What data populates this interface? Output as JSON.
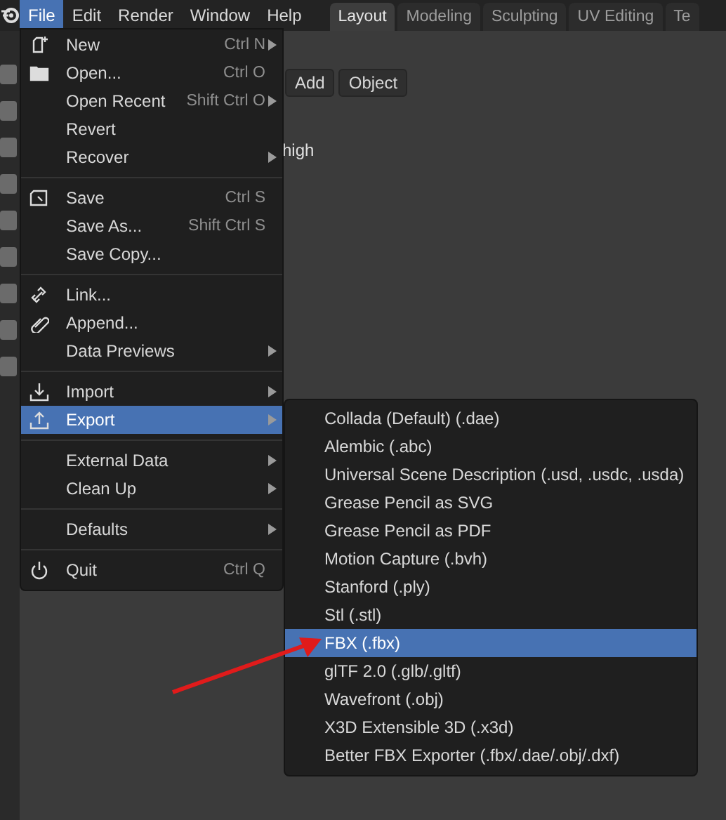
{
  "menubar": [
    {
      "label": "File",
      "selected": true
    },
    {
      "label": "Edit",
      "selected": false
    },
    {
      "label": "Render",
      "selected": false
    },
    {
      "label": "Window",
      "selected": false
    },
    {
      "label": "Help",
      "selected": false
    }
  ],
  "workspace_tabs": [
    {
      "label": "Layout",
      "selected": true
    },
    {
      "label": "Modeling",
      "selected": false
    },
    {
      "label": "Sculpting",
      "selected": false
    },
    {
      "label": "UV Editing",
      "selected": false
    },
    {
      "label": "Te",
      "selected": false
    }
  ],
  "header_buttons": [
    "Add",
    "Object"
  ],
  "viewport_text": "high",
  "file_menu": [
    [
      {
        "label": "New",
        "shortcut": "Ctrl N",
        "submenu": true,
        "selected": false
      },
      {
        "label": "Open...",
        "shortcut": "Ctrl O",
        "submenu": false,
        "selected": false
      },
      {
        "label": "Open Recent",
        "shortcut": "Shift Ctrl O",
        "submenu": true,
        "selected": false
      },
      {
        "label": "Revert",
        "submenu": false,
        "selected": false
      },
      {
        "label": "Recover",
        "submenu": true,
        "selected": false
      }
    ],
    [
      {
        "label": "Save",
        "shortcut": "Ctrl S",
        "submenu": false,
        "selected": false
      },
      {
        "label": "Save As...",
        "shortcut": "Shift Ctrl S",
        "submenu": false,
        "selected": false
      },
      {
        "label": "Save Copy...",
        "submenu": false,
        "selected": false
      }
    ],
    [
      {
        "label": "Link...",
        "submenu": false,
        "selected": false
      },
      {
        "label": "Append...",
        "submenu": false,
        "selected": false
      },
      {
        "label": "Data Previews",
        "submenu": true,
        "selected": false
      }
    ],
    [
      {
        "label": "Import",
        "submenu": true,
        "selected": false
      },
      {
        "label": "Export",
        "submenu": true,
        "selected": true
      }
    ],
    [
      {
        "label": "External Data",
        "submenu": true,
        "selected": false
      },
      {
        "label": "Clean Up",
        "submenu": true,
        "selected": false
      }
    ],
    [
      {
        "label": "Defaults",
        "submenu": true,
        "selected": false
      }
    ],
    [
      {
        "label": "Quit",
        "shortcut": "Ctrl Q",
        "submenu": false,
        "selected": false
      }
    ]
  ],
  "export_menu": [
    {
      "label": "Collada (Default) (.dae)",
      "selected": false
    },
    {
      "label": "Alembic (.abc)",
      "selected": false
    },
    {
      "label": "Universal Scene Description (.usd, .usdc, .usda)",
      "selected": false
    },
    {
      "label": "Grease Pencil as SVG",
      "selected": false
    },
    {
      "label": "Grease Pencil as PDF",
      "selected": false
    },
    {
      "label": "Motion Capture (.bvh)",
      "selected": false
    },
    {
      "label": "Stanford (.ply)",
      "selected": false
    },
    {
      "label": "Stl (.stl)",
      "selected": false
    },
    {
      "label": "FBX (.fbx)",
      "selected": true
    },
    {
      "label": "glTF 2.0 (.glb/.gltf)",
      "selected": false
    },
    {
      "label": "Wavefront (.obj)",
      "selected": false
    },
    {
      "label": "X3D Extensible 3D (.x3d)",
      "selected": false
    },
    {
      "label": "Better FBX Exporter (.fbx/.dae/.obj/.dxf)",
      "selected": false
    }
  ]
}
